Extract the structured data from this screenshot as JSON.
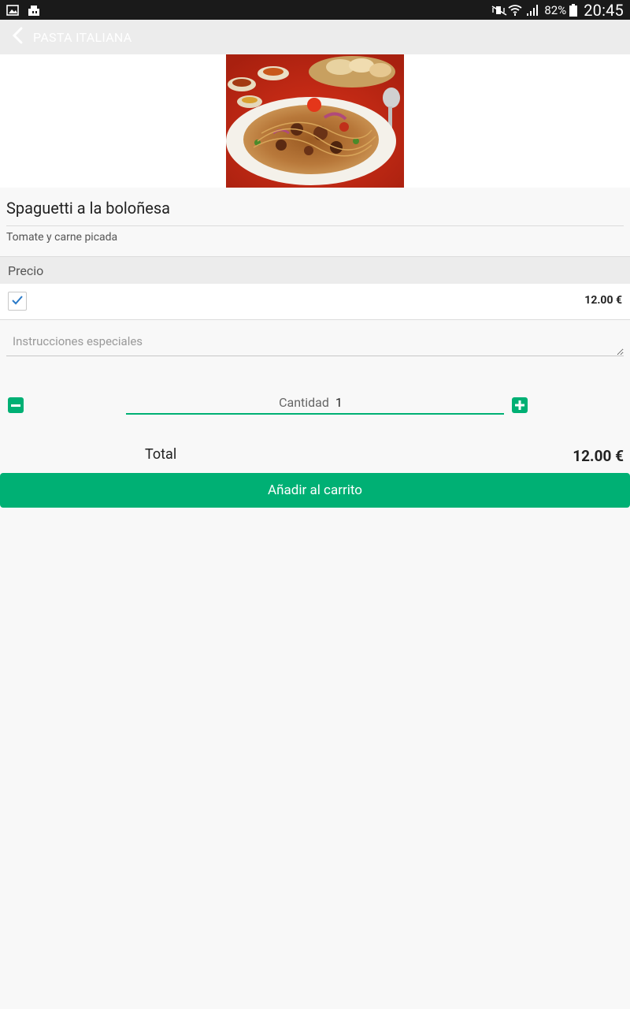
{
  "status_bar": {
    "battery": "82%",
    "time": "20:45",
    "icons": [
      "gallery-icon",
      "store-icon",
      "mute-icon",
      "wifi-icon",
      "signal-icon",
      "battery-icon"
    ]
  },
  "app_bar": {
    "title": "PASTA ITALIANA",
    "back_icon": "chevron-left-icon"
  },
  "product": {
    "name": "Spaguetti a la boloñesa",
    "description": "Tomate y carne picada",
    "image_subject": "plate of spaghetti with meat and tomatoes"
  },
  "price_section": {
    "header": "Precio",
    "checked": true,
    "price": "12.00 €"
  },
  "instructions": {
    "placeholder": "Instrucciones especiales",
    "value": ""
  },
  "quantity": {
    "label": "Cantidad",
    "value": "1"
  },
  "total": {
    "label": "Total",
    "value": "12.00 €"
  },
  "add_button": {
    "label": "Añadir al carrito"
  },
  "colors": {
    "accent": "#00b074",
    "status_bar": "#1a1a1a",
    "app_bar": "#ececec",
    "background": "#f8f8f8"
  }
}
